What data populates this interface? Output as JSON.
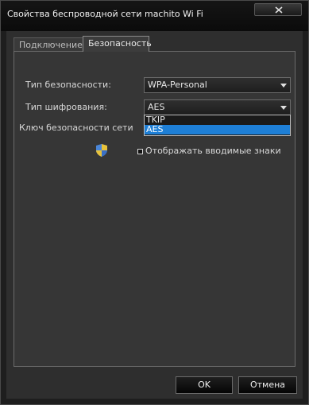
{
  "window": {
    "title": "Свойства беспроводной сети machito Wi Fi"
  },
  "tabs": [
    {
      "label": "Подключение",
      "active": false
    },
    {
      "label": "Безопасность",
      "active": true
    }
  ],
  "security": {
    "security_type_label": "Тип безопасности:",
    "security_type_value": "WPA-Personal",
    "encryption_type_label": "Тип шифрования:",
    "encryption_type_value": "AES",
    "encryption_options": [
      "TKIP",
      "AES"
    ],
    "encryption_selected": "AES",
    "network_key_label": "Ключ безопасности сети",
    "show_characters_label": "Отображать вводимые знаки",
    "show_characters_checked": false
  },
  "buttons": {
    "ok": "OK",
    "cancel": "Отмена"
  },
  "colors": {
    "selection": "#1e7fd6",
    "background": "#363636"
  },
  "icons": {
    "close": "close-icon",
    "shield": "shield-icon"
  }
}
